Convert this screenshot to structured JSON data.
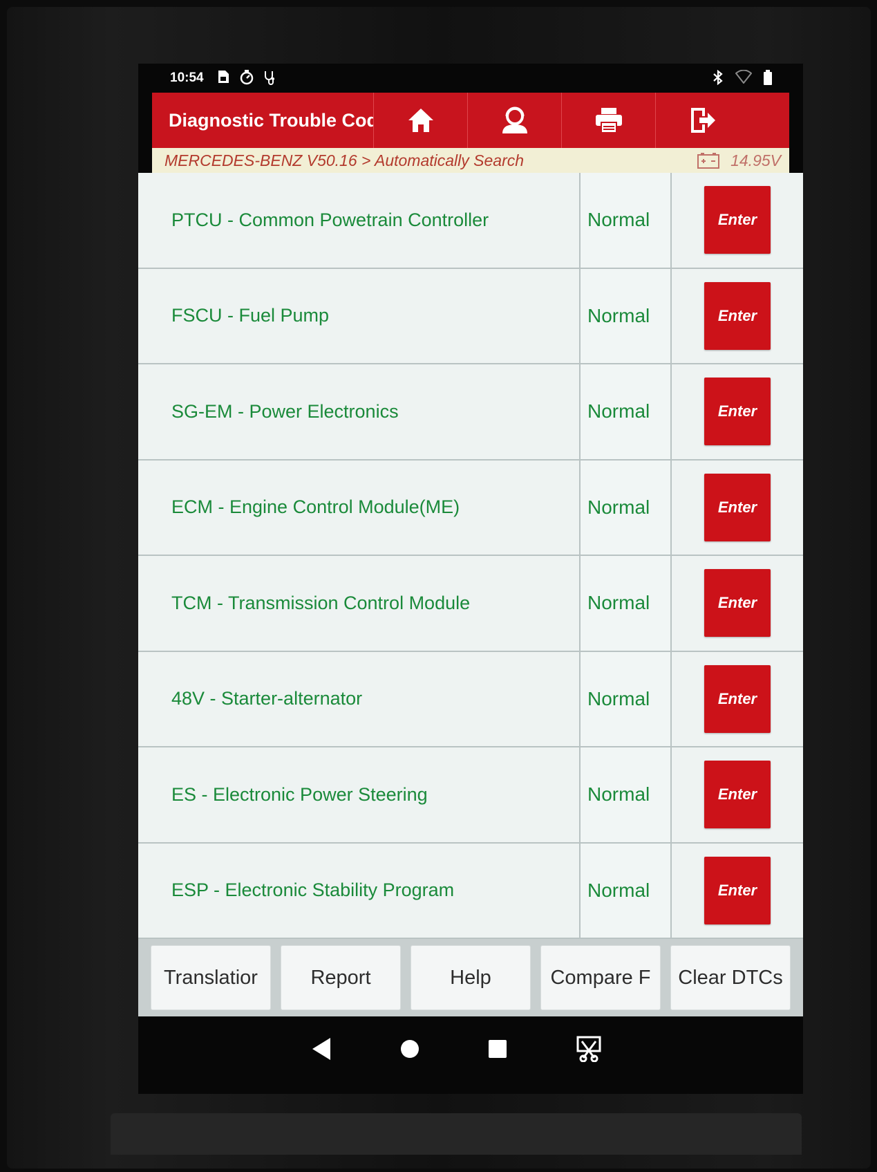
{
  "status_bar": {
    "time": "10:54",
    "left_icons": [
      "sim-card-icon",
      "timer-icon",
      "stethoscope-icon"
    ],
    "right_icons": [
      "bluetooth-icon",
      "wifi-icon",
      "battery-icon"
    ]
  },
  "header": {
    "title": "Diagnostic Trouble Cod",
    "buttons": [
      "home-icon",
      "support-person-icon",
      "print-icon",
      "exit-icon"
    ],
    "color": "#c8141e"
  },
  "breadcrumb": {
    "path": "MERCEDES-BENZ V50.16 > Automatically Search",
    "voltage": "14.95V"
  },
  "modules": [
    {
      "name": "PTCU - Common Powetrain Controller",
      "status": "Normal",
      "action": "Enter"
    },
    {
      "name": "FSCU - Fuel Pump",
      "status": "Normal",
      "action": "Enter"
    },
    {
      "name": "SG-EM - Power Electronics",
      "status": "Normal",
      "action": "Enter"
    },
    {
      "name": "ECM - Engine Control Module(ME)",
      "status": "Normal",
      "action": "Enter"
    },
    {
      "name": "TCM - Transmission Control Module",
      "status": "Normal",
      "action": "Enter"
    },
    {
      "name": "48V - Starter-alternator",
      "status": "Normal",
      "action": "Enter"
    },
    {
      "name": "ES - Electronic Power Steering",
      "status": "Normal",
      "action": "Enter"
    },
    {
      "name": "ESP - Electronic Stability Program",
      "status": "Normal",
      "action": "Enter"
    }
  ],
  "toolbar": {
    "translation": "Translatior",
    "report": "Report",
    "help": "Help",
    "compare": "Compare F",
    "clear": "Clear DTCs"
  },
  "nav": [
    "back-icon",
    "home-circle-icon",
    "recents-icon",
    "screenshot-icon"
  ],
  "colors": {
    "text_green": "#1a8a3a",
    "enter_red": "#cc1219"
  }
}
